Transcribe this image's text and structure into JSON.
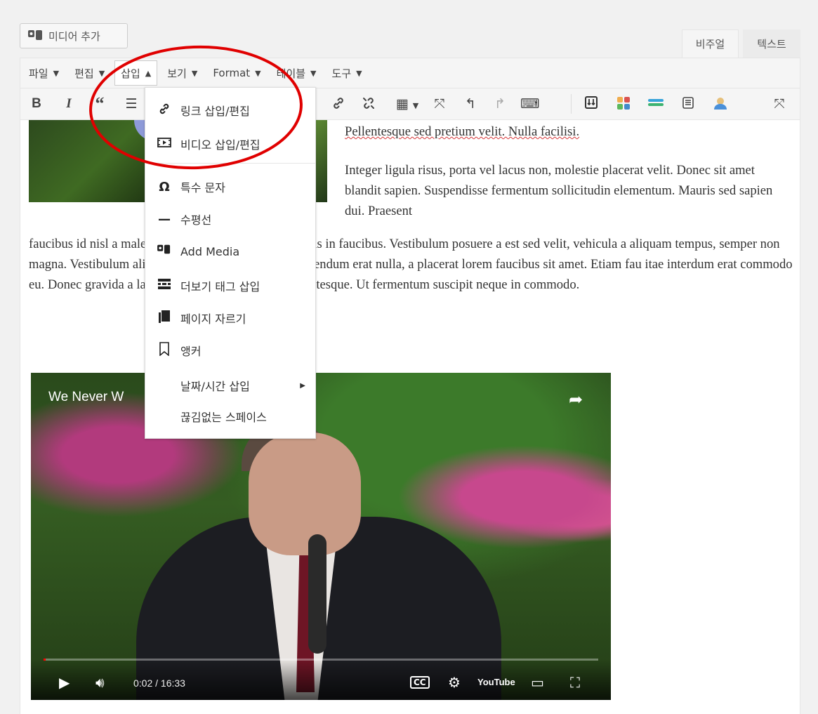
{
  "top": {
    "add_media_label": "미디어 추가",
    "tabs": [
      "비주얼",
      "텍스트"
    ]
  },
  "menubar": {
    "items": [
      {
        "label": "파일"
      },
      {
        "label": "편집"
      },
      {
        "label": "삽입",
        "active": true
      },
      {
        "label": "보기"
      },
      {
        "label": "Format"
      },
      {
        "label": "테이블"
      },
      {
        "label": "도구"
      }
    ]
  },
  "toolbar": {
    "icons": [
      "bold-icon",
      "italic-icon",
      "blockquote-icon",
      "bulleted-list-icon",
      "link-icon",
      "unlink-icon",
      "table-icon",
      "fullscreen-toggle-icon",
      "undo-icon",
      "redo-icon",
      "keyboard-icon",
      "insert-icon",
      "color-grid-icon",
      "horizontal-bar-icon",
      "document-icon",
      "user-icon",
      "distraction-free-icon"
    ]
  },
  "insert_menu": {
    "items": [
      {
        "icon": "link-icon",
        "label": "링크 삽입/편집"
      },
      {
        "icon": "video-icon",
        "label": "비디오 삽입/편집"
      },
      {
        "icon": "omega-icon",
        "label": "특수 문자"
      },
      {
        "icon": "horizontal-line-icon",
        "label": "수평선"
      },
      {
        "icon": "add-media-icon",
        "label": "Add Media"
      },
      {
        "icon": "more-tag-icon",
        "label": "더보기 태그 삽입"
      },
      {
        "icon": "page-break-icon",
        "label": "페이지 자르기"
      },
      {
        "icon": "anchor-icon",
        "label": "앵커"
      },
      {
        "icon": "",
        "label": "날짜/시간 삽입",
        "has_submenu": true
      },
      {
        "icon": "",
        "label": "끊김없는 스페이스"
      }
    ]
  },
  "content": {
    "p1": "Pellentesque sed pretium velit. Nulla facilisi.",
    "p2": "Integer ligula risus, porta vel lacus non, molestie placerat velit. Donec sit amet blandit sapien. Suspendisse fermentum sollicitudin elementum. Mauris sed sapien dui. Praesent",
    "p3": "faucibus id nisl a malesuada fames ac ante ipsum primis in faucibus. Vestibulum posuere a est sed velit, vehicula a aliquam tempus, semper non magna. Vestibulum aliquam laoreet o libero. Fusce bibendum erat nulla, a placerat lorem faucibus sit amet. Etiam fau itae interdum erat commodo eu. Donec gravida a lacus vitae eleifend. Nunc c pellentesque. Ut fermentum suscipit neque in commodo."
  },
  "video": {
    "title": "We Never W",
    "time": "0:02 / 16:33",
    "progress": 0.002,
    "youtube_label": "YouTube"
  },
  "colors": {
    "annotation": "#e00000",
    "accent": "#0073aa"
  }
}
